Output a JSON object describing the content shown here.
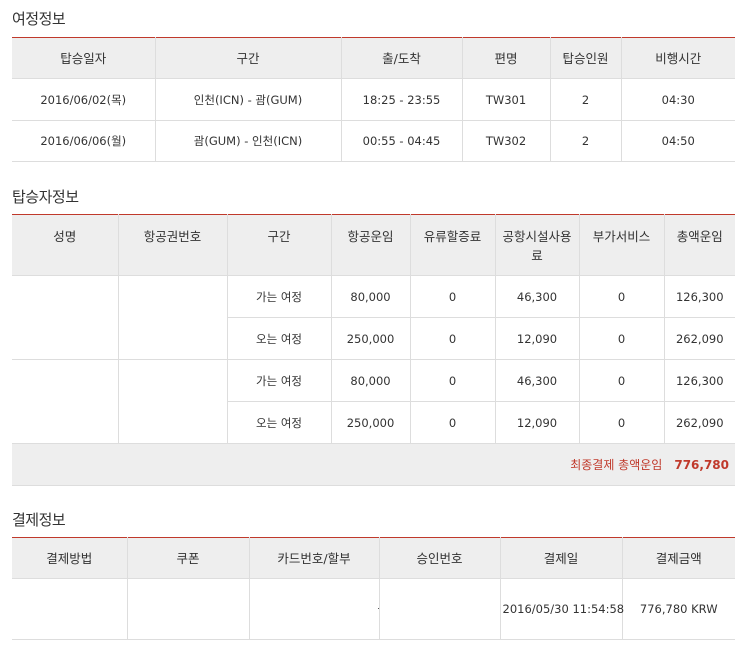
{
  "itinerary": {
    "title": "여정정보",
    "headers": [
      "탑승일자",
      "구간",
      "출/도착",
      "편명",
      "탑승인원",
      "비행시간"
    ],
    "rows": [
      {
        "date": "2016/06/02(목)",
        "route": "인천(ICN) - 괌(GUM)",
        "time": "18:25 - 23:55",
        "flight": "TW301",
        "pax": "2",
        "duration": "04:30"
      },
      {
        "date": "2016/06/06(월)",
        "route": "괌(GUM) - 인천(ICN)",
        "time": "00:55 - 04:45",
        "flight": "TW302",
        "pax": "2",
        "duration": "04:50"
      }
    ]
  },
  "passengers": {
    "title": "탑승자정보",
    "headers": [
      "성명",
      "항공권번호",
      "구간",
      "항공운임",
      "유류할증료",
      "공항시설사용료",
      "부가서비스",
      "총액운임"
    ],
    "groups": [
      {
        "name": "",
        "ticket": "",
        "legs": [
          {
            "leg": "가는 여정",
            "fare": "80,000",
            "fuel": "0",
            "airport": "46,300",
            "extra": "0",
            "total": "126,300"
          },
          {
            "leg": "오는 여정",
            "fare": "250,000",
            "fuel": "0",
            "airport": "12,090",
            "extra": "0",
            "total": "262,090"
          }
        ]
      },
      {
        "name": "",
        "ticket": "",
        "legs": [
          {
            "leg": "가는 여정",
            "fare": "80,000",
            "fuel": "0",
            "airport": "46,300",
            "extra": "0",
            "total": "126,300"
          },
          {
            "leg": "오는 여정",
            "fare": "250,000",
            "fuel": "0",
            "airport": "12,090",
            "extra": "0",
            "total": "262,090"
          }
        ]
      }
    ],
    "total_label": "최종결제 총액운임",
    "total_value": "776,780"
  },
  "payment": {
    "title": "결제정보",
    "headers": [
      "결제방법",
      "쿠폰",
      "카드번호/할부",
      "승인번호",
      "결제일",
      "결제금액"
    ],
    "row": {
      "method": "",
      "coupon": "",
      "card": "",
      "approval": "",
      "date": "2016/05/30 11:54:58",
      "amount": "776,780 KRW"
    }
  },
  "colors": {
    "accent": "#c0392b",
    "header_bg": "#eeeeee",
    "border": "#dddddd"
  }
}
